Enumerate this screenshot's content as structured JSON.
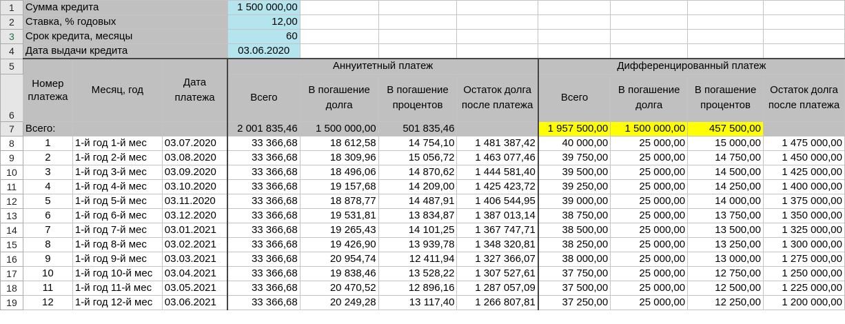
{
  "params": [
    {
      "label": "Сумма кредита",
      "value": "1 500 000,00"
    },
    {
      "label": "Ставка, % годовых",
      "value": "12,00"
    },
    {
      "label": "Срок кредита, месяцы",
      "value": "60"
    },
    {
      "label": "Дата выдачи кредита",
      "value": "03.06.2020"
    }
  ],
  "row_numbers": [
    "1",
    "2",
    "3",
    "4",
    "5",
    "6",
    "7",
    "8",
    "9",
    "10",
    "11",
    "12",
    "13",
    "14",
    "15",
    "16",
    "17",
    "18",
    "19"
  ],
  "headers": {
    "num": "Номер платежа",
    "month": "Месяц, год",
    "date": "Дата платежа",
    "annuity_group": "Аннуитетный платеж",
    "diff_group": "Дифференцированный платеж",
    "total": "Всего",
    "principal": "В погашение долга",
    "interest": "В погашение процентов",
    "balance": "Остаток долга после платежа"
  },
  "totals": {
    "label": "Всего:",
    "ann_total": "2 001 835,46",
    "ann_principal": "1 500 000,00",
    "ann_interest": "501 835,46",
    "diff_total": "1 957 500,00",
    "diff_principal": "1 500 000,00",
    "diff_interest": "457 500,00"
  },
  "colors": {
    "header_gray": "#c0c0c0",
    "param_teal": "#b4e5ee",
    "highlight_yellow": "#ffff00"
  },
  "rows": [
    {
      "n": "1",
      "m": "1-й год 1-й мес",
      "d": "03.07.2020",
      "at": "33 366,68",
      "ap": "18 612,58",
      "ai": "14 754,10",
      "ab": "1 481 387,42",
      "dt": "40 000,00",
      "dp": "25 000,00",
      "di": "15 000,00",
      "db": "1 475 000,00"
    },
    {
      "n": "2",
      "m": "1-й год 2-й мес",
      "d": "03.08.2020",
      "at": "33 366,68",
      "ap": "18 309,96",
      "ai": "15 056,72",
      "ab": "1 463 077,46",
      "dt": "39 750,00",
      "dp": "25 000,00",
      "di": "14 750,00",
      "db": "1 450 000,00"
    },
    {
      "n": "3",
      "m": "1-й год 3-й мес",
      "d": "03.09.2020",
      "at": "33 366,68",
      "ap": "18 496,06",
      "ai": "14 870,62",
      "ab": "1 444 581,40",
      "dt": "39 500,00",
      "dp": "25 000,00",
      "di": "14 500,00",
      "db": "1 425 000,00"
    },
    {
      "n": "4",
      "m": "1-й год 4-й мес",
      "d": "03.10.2020",
      "at": "33 366,68",
      "ap": "19 157,68",
      "ai": "14 209,00",
      "ab": "1 425 423,72",
      "dt": "39 250,00",
      "dp": "25 000,00",
      "di": "14 250,00",
      "db": "1 400 000,00"
    },
    {
      "n": "5",
      "m": "1-й год 5-й мес",
      "d": "03.11.2020",
      "at": "33 366,68",
      "ap": "18 878,77",
      "ai": "14 487,91",
      "ab": "1 406 544,95",
      "dt": "39 000,00",
      "dp": "25 000,00",
      "di": "14 000,00",
      "db": "1 375 000,00"
    },
    {
      "n": "6",
      "m": "1-й год 6-й мес",
      "d": "03.12.2020",
      "at": "33 366,68",
      "ap": "19 531,81",
      "ai": "13 834,87",
      "ab": "1 387 013,14",
      "dt": "38 750,00",
      "dp": "25 000,00",
      "di": "13 750,00",
      "db": "1 350 000,00"
    },
    {
      "n": "7",
      "m": "1-й год 7-й мес",
      "d": "03.01.2021",
      "at": "33 366,68",
      "ap": "19 265,43",
      "ai": "14 101,25",
      "ab": "1 367 747,71",
      "dt": "38 500,00",
      "dp": "25 000,00",
      "di": "13 500,00",
      "db": "1 325 000,00"
    },
    {
      "n": "8",
      "m": "1-й год 8-й мес",
      "d": "03.02.2021",
      "at": "33 366,68",
      "ap": "19 426,90",
      "ai": "13 939,78",
      "ab": "1 348 320,81",
      "dt": "38 250,00",
      "dp": "25 000,00",
      "di": "13 250,00",
      "db": "1 300 000,00"
    },
    {
      "n": "9",
      "m": "1-й год 9-й мес",
      "d": "03.03.2021",
      "at": "33 366,68",
      "ap": "20 954,74",
      "ai": "12 411,94",
      "ab": "1 327 366,07",
      "dt": "38 000,00",
      "dp": "25 000,00",
      "di": "13 000,00",
      "db": "1 275 000,00"
    },
    {
      "n": "10",
      "m": "1-й год 10-й мес",
      "d": "03.04.2021",
      "at": "33 366,68",
      "ap": "19 838,46",
      "ai": "13 528,22",
      "ab": "1 307 527,61",
      "dt": "37 750,00",
      "dp": "25 000,00",
      "di": "12 750,00",
      "db": "1 250 000,00"
    },
    {
      "n": "11",
      "m": "1-й год 11-й мес",
      "d": "03.05.2021",
      "at": "33 366,68",
      "ap": "20 470,52",
      "ai": "12 896,16",
      "ab": "1 287 057,09",
      "dt": "37 500,00",
      "dp": "25 000,00",
      "di": "12 500,00",
      "db": "1 225 000,00"
    },
    {
      "n": "12",
      "m": "1-й год 12-й мес",
      "d": "03.06.2021",
      "at": "33 366,68",
      "ap": "20 249,28",
      "ai": "13 117,40",
      "ab": "1 266 807,81",
      "dt": "37 250,00",
      "dp": "25 000,00",
      "di": "12 250,00",
      "db": "1 200 000,00"
    }
  ]
}
